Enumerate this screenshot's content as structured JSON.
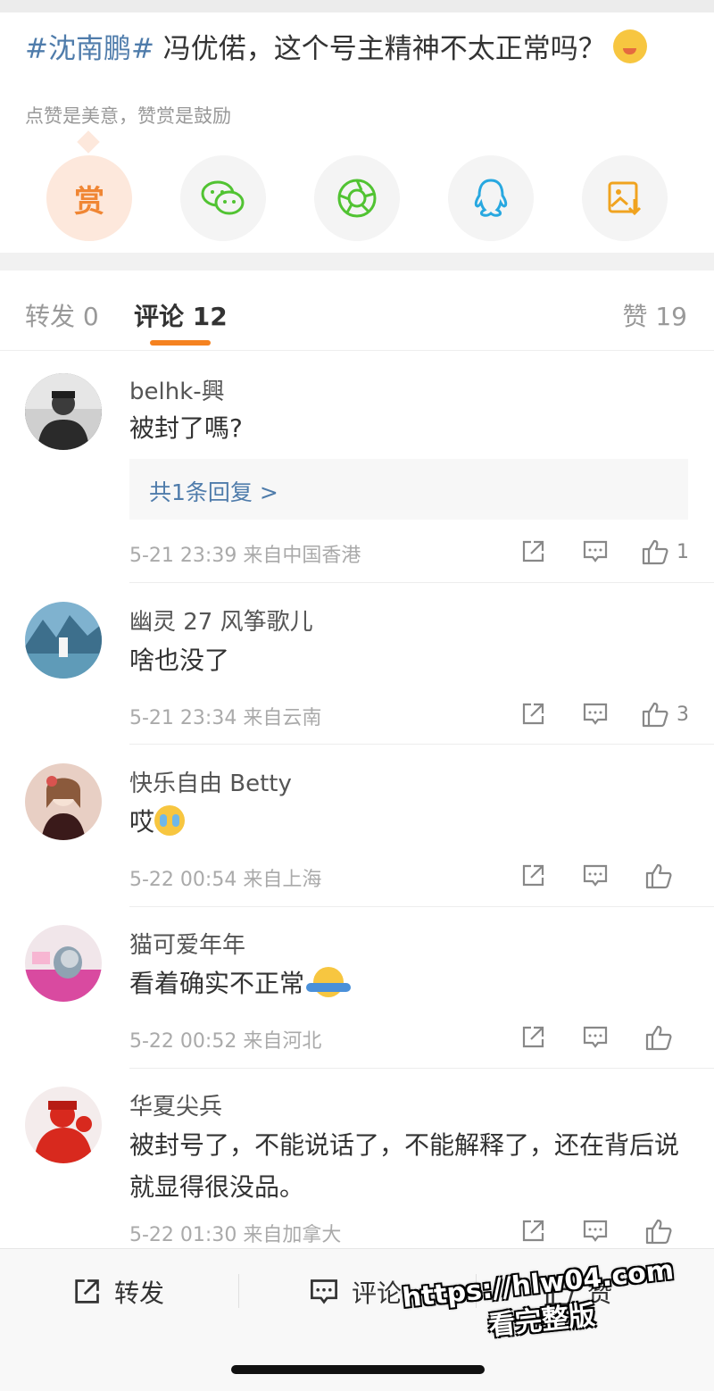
{
  "post": {
    "hashtag": "#沈南鹏#",
    "title_text": " 冯优偌，这个号主精神不太正常吗？",
    "title_emoji": "savoring-food-emoji",
    "reward_hint": "点赞是美意，赞赏是鼓励",
    "reward_label": "赏",
    "share_icons": [
      "reward-icon",
      "wechat-icon",
      "moments-icon",
      "qq-icon",
      "save-image-icon"
    ]
  },
  "tabs": {
    "repost": "转发 0",
    "comments": "评论 12",
    "likes": "赞 19"
  },
  "comments": [
    {
      "name": "belhk-興",
      "text": "被封了嗎?",
      "reply": "共1条回复 >",
      "time": "5-21 23:39",
      "location": "来自中国香港",
      "likes": "1"
    },
    {
      "name": "幽灵 27 风筝歌儿",
      "text": "啥也没了",
      "time": "5-21 23:34",
      "location": "来自云南",
      "likes": "3"
    },
    {
      "name": "快乐自由 Betty",
      "text": "哎",
      "time": "5-22 00:54",
      "location": "来自上海",
      "likes": ""
    },
    {
      "name": "猫可爱年年",
      "text": "看着确实不正常",
      "time": "5-22 00:52",
      "location": "来自河北",
      "likes": ""
    },
    {
      "name": "华夏尖兵",
      "text": "被封号了，不能说话了，不能解释了，还在背后说就显得很没品。",
      "time": "5-22 01:30",
      "location": "来自加拿大",
      "likes": ""
    }
  ],
  "bottom_bar": {
    "repost": "转发",
    "comment": "评论",
    "like": "赞"
  },
  "watermark": {
    "url": "https://hlw04.com",
    "subtitle": "看完整版"
  },
  "colors": {
    "accent": "#f58220",
    "link": "#4f7cab",
    "wechat": "#51c332",
    "qq": "#28a8e0"
  }
}
